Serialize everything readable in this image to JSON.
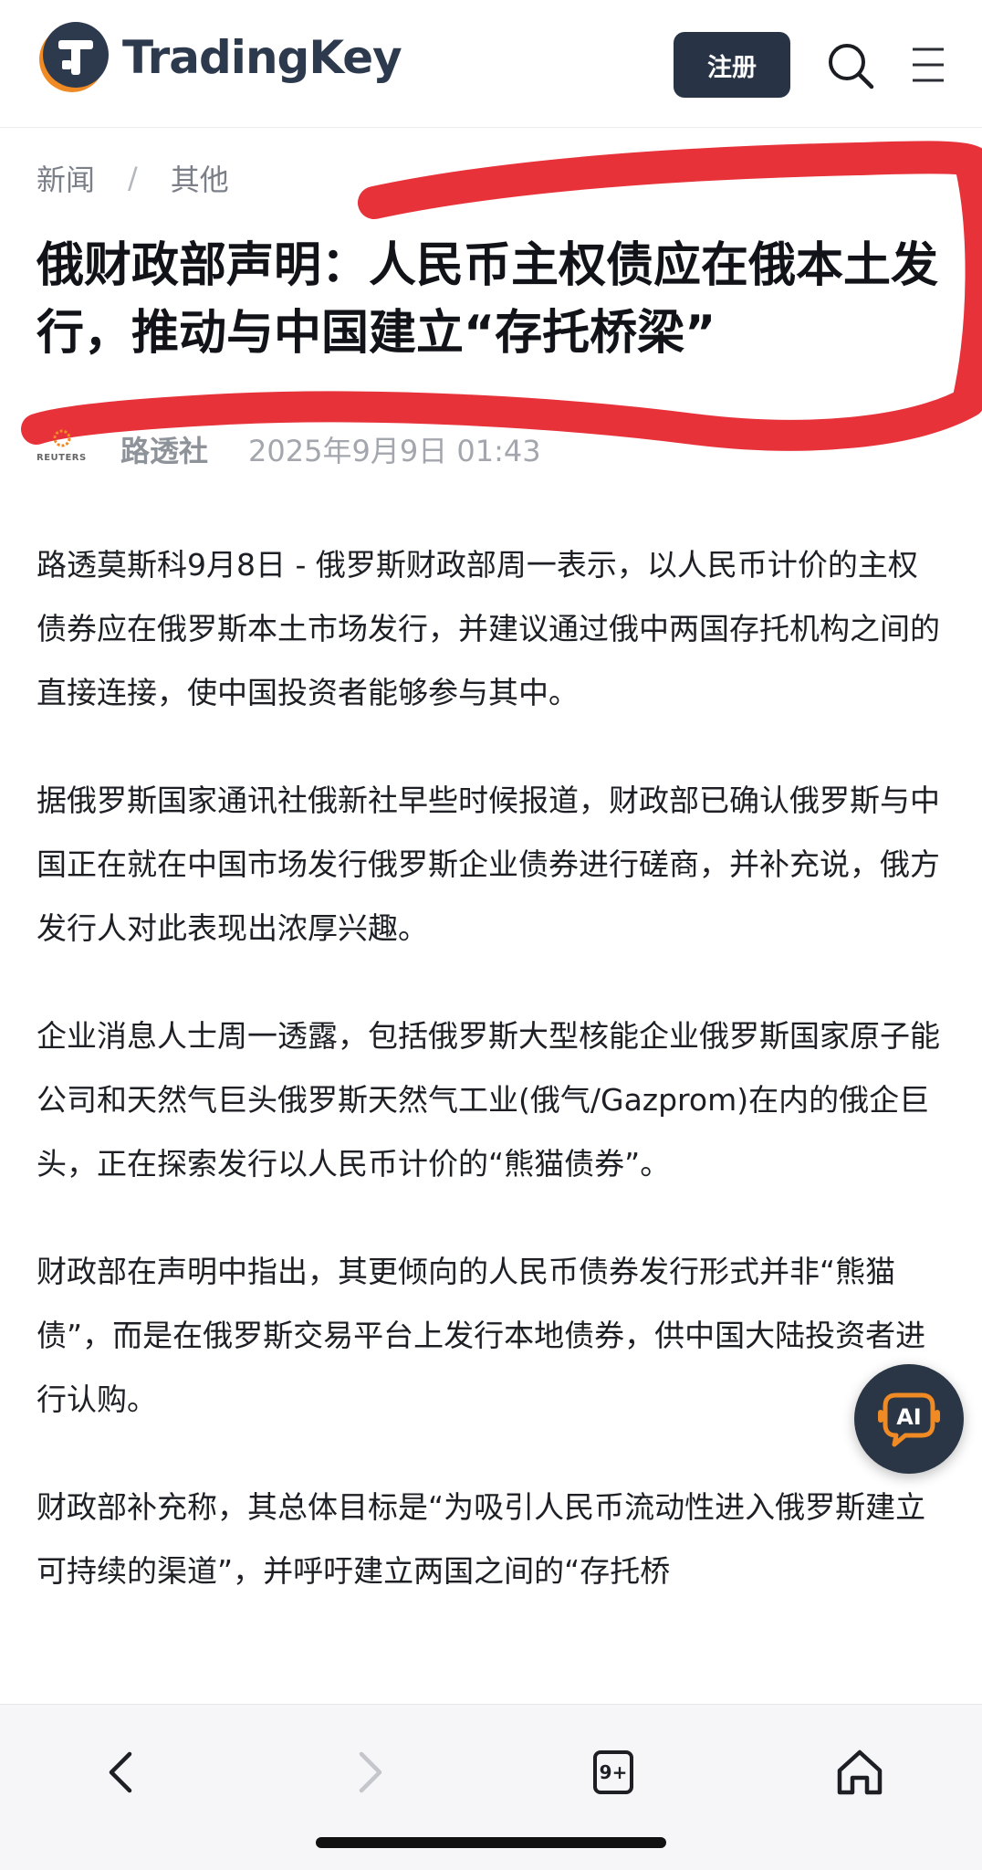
{
  "header": {
    "brand": "TradingKey",
    "register_label": "注册"
  },
  "breadcrumb": {
    "items": [
      "新闻",
      "其他"
    ],
    "separator": "/"
  },
  "article": {
    "title": "俄财政部声明：人民币主权债应在俄本土发行，推动与中国建立“存托桥梁”",
    "source": {
      "logo_text": "REUTERS",
      "name": "路透社",
      "time": "2025年9月9日 01:43"
    },
    "paragraphs": [
      "路透莫斯科9月8日 - 俄罗斯财政部周一表示，以人民币计价的主权债券应在俄罗斯本土市场发行，并建议通过俄中两国存托机构之间的直接连接，使中国投资者能够参与其中。",
      "据俄罗斯国家通讯社俄新社早些时候报道，财政部已确认俄罗斯与中国正在就在中国市场发行俄罗斯企业债券进行磋商，并补充说，俄方发行人对此表现出浓厚兴趣。",
      "企业消息人士周一透露，包括俄罗斯大型核能企业俄罗斯国家原子能公司和天然气巨头俄罗斯天然气工业(俄气/Gazprom)在内的俄企巨头，正在探索发行以人民币计价的“熊猫债券”。",
      "财政部在声明中指出，其更倾向的人民币债券发行形式并非“熊猫债”，而是在俄罗斯交易平台上发行本地债券，供中国大陆投资者进行认购。",
      "财政部补充称，其总体目标是“为吸引人民币流动性进入俄罗斯建立可持续的渠道”，并呼吁建立两国之间的“存托桥"
    ]
  },
  "ai_button": {
    "label": "AI"
  },
  "browser_bar": {
    "tabs_count": "9+"
  },
  "colors": {
    "brand_dark": "#283445",
    "logo_orange": "#f08a24",
    "annotation_red": "#e8323a"
  },
  "icons": {
    "logo": "tradingkey-logo-icon",
    "search": "search-icon",
    "menu": "hamburger-menu-icon",
    "ai": "ai-assistant-icon",
    "back": "chevron-left-icon",
    "forward": "chevron-right-icon",
    "tabs": "tabs-icon",
    "home": "home-icon"
  }
}
